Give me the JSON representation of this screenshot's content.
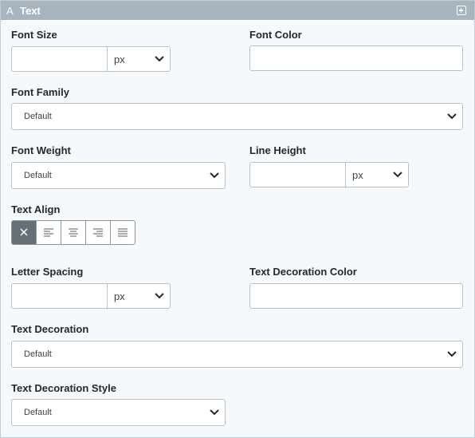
{
  "panel": {
    "title": "Text",
    "title_icon": "A",
    "add_icon": "plus-square-icon"
  },
  "font_size": {
    "label": "Font Size",
    "value": "",
    "unit": "px"
  },
  "font_color": {
    "label": "Font Color",
    "value": ""
  },
  "font_family": {
    "label": "Font Family",
    "value": "Default"
  },
  "font_weight": {
    "label": "Font Weight",
    "value": "Default"
  },
  "line_height": {
    "label": "Line Height",
    "value": "",
    "unit": "px"
  },
  "text_align": {
    "label": "Text Align",
    "options": [
      "none",
      "left",
      "center",
      "right",
      "justify"
    ],
    "selected": "none"
  },
  "letter_spacing": {
    "label": "Letter Spacing",
    "value": "",
    "unit": "px"
  },
  "text_decoration_color": {
    "label": "Text Decoration Color",
    "value": ""
  },
  "text_decoration": {
    "label": "Text Decoration",
    "value": "Default"
  },
  "text_decoration_style": {
    "label": "Text Decoration Style",
    "value": "Default"
  },
  "colors": {
    "header_bg": "#a8b5bf",
    "panel_bg": "#f5f9fc",
    "active_align_bg": "#646f78"
  }
}
